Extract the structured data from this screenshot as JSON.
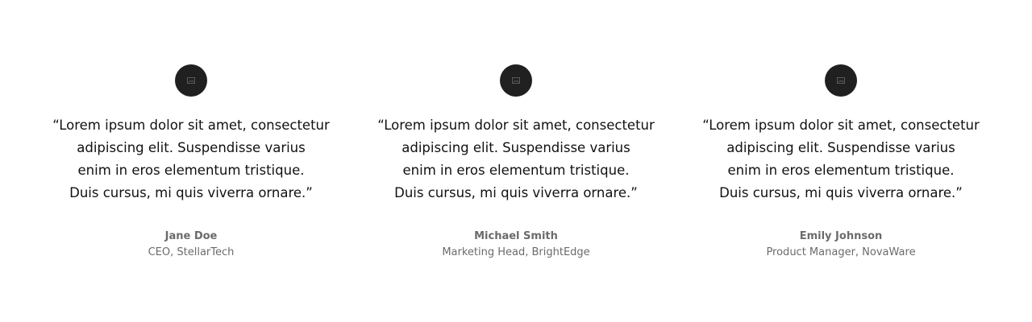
{
  "testimonials": [
    {
      "avatar_icon": "image-placeholder-icon",
      "quote_lines": [
        "“Lorem ipsum dolor sit amet, consectetur",
        "adipiscing elit. Suspendisse varius",
        "enim in eros elementum tristique.",
        "Duis cursus, mi quis viverra ornare.”"
      ],
      "name": "Jane Doe",
      "role": "CEO, StellarTech"
    },
    {
      "avatar_icon": "image-placeholder-icon",
      "quote_lines": [
        "“Lorem ipsum dolor sit amet, consectetur",
        "adipiscing elit. Suspendisse varius",
        "enim in eros elementum tristique.",
        "Duis cursus, mi quis viverra ornare.”"
      ],
      "name": "Michael Smith",
      "role": "Marketing Head, BrightEdge"
    },
    {
      "avatar_icon": "image-placeholder-icon",
      "quote_lines": [
        "“Lorem ipsum dolor sit amet, consectetur",
        "adipiscing elit. Suspendisse varius",
        "enim in eros elementum tristique.",
        "Duis cursus, mi quis viverra ornare.”"
      ],
      "name": "Emily Johnson",
      "role": "Product Manager, NovaWare"
    }
  ],
  "colors": {
    "avatar_bg": "#202020",
    "quote_text": "#111111",
    "meta_text": "#6b6b6b",
    "background": "#ffffff"
  }
}
